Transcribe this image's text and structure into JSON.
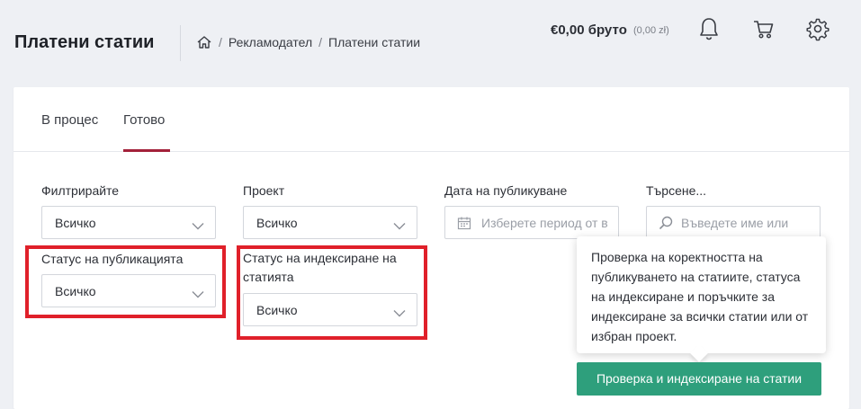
{
  "header": {
    "title": "Платени статии",
    "breadcrumb": [
      "Рекламодател",
      "Платени статии"
    ],
    "balance": "€0,00 брутo",
    "balance_sub": "(0,00 zł)"
  },
  "tabs": [
    {
      "label": "В процес",
      "active": false
    },
    {
      "label": "Готово",
      "active": true
    }
  ],
  "filters": {
    "filter": {
      "label": "Филтрирайте",
      "value": "Всичко"
    },
    "project": {
      "label": "Проект",
      "value": "Всичко"
    },
    "date": {
      "label": "Дата на публикуване",
      "placeholder": "Изберете период от в"
    },
    "search": {
      "label": "Търсене...",
      "placeholder": "Въведете име или"
    },
    "publication_status": {
      "label": "Статус на публикацията",
      "value": "Всичко"
    },
    "indexing_status": {
      "label": "Статус на индексиране на статията",
      "value": "Всичко"
    }
  },
  "tooltip": {
    "text": "Проверка на коректността на публикуването на статиите, статуса на индексиране и поръчките за индексиране за всички статии или от избран проект."
  },
  "actions": {
    "check_index_label": "Проверка и индексиране на статии"
  },
  "colors": {
    "accent": "#a3213a",
    "button": "#2e9f7c",
    "highlight": "#e0202a"
  }
}
